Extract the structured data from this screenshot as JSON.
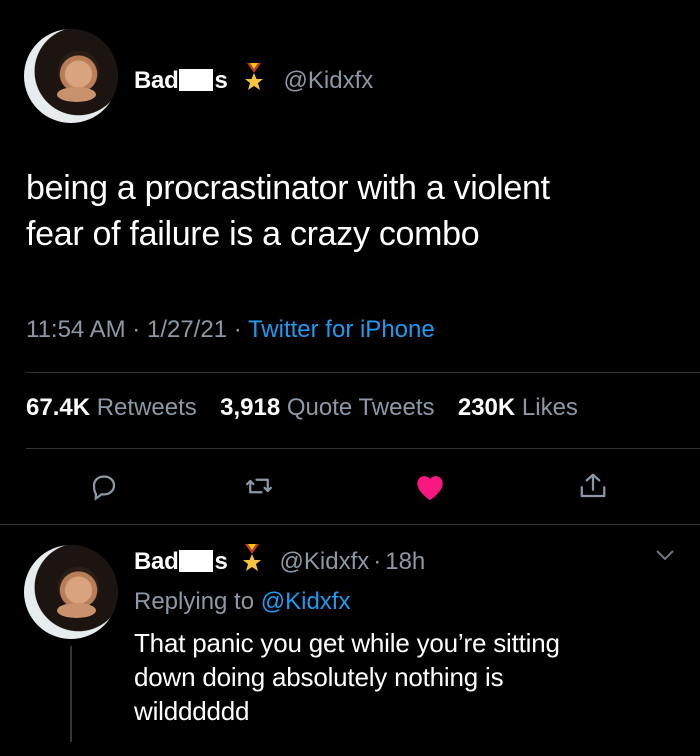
{
  "tweet": {
    "author": {
      "name_start": "Bad",
      "name_end": "s",
      "handle": "@Kidxfx",
      "badge_icon": "medal-icon"
    },
    "text_line1": "being a procrastinator with a violent",
    "text_line2": "fear of failure is a crazy combo",
    "meta": {
      "time": "11:54 AM",
      "sep1": "·",
      "date": "1/27/21",
      "sep2": "·",
      "source": "Twitter for iPhone"
    },
    "stats": {
      "retweets_count": "67.4K",
      "retweets_label": "Retweets",
      "quotes_count": "3,918",
      "quotes_label": "Quote Tweets",
      "likes_count": "230K",
      "likes_label": "Likes"
    },
    "actions": [
      "reply-icon",
      "retweet-icon",
      "heart-icon",
      "share-icon"
    ],
    "colors": {
      "like": "#f91880",
      "link": "#1d9bf0",
      "muted": "#8b98a5"
    }
  },
  "reply": {
    "author": {
      "name_start": "Bad",
      "name_end": "s",
      "handle": "@Kidxfx",
      "sep": "·",
      "age": "18h"
    },
    "replying_prefix": "Replying to",
    "replying_handle": "@Kidxfx",
    "text_line1": "That panic you get while you’re sitting",
    "text_line2": "down doing absolutely nothing is",
    "text_line3": "wildddddd"
  }
}
